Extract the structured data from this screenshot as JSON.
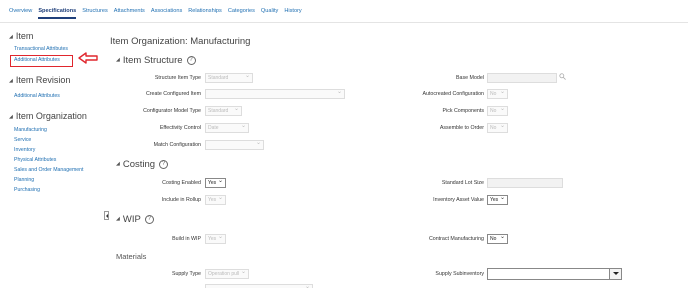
{
  "tabs": [
    "Overview",
    "Specifications",
    "Structures",
    "Attachments",
    "Associations",
    "Relationships",
    "Categories",
    "Quality",
    "History"
  ],
  "active_tab": "Specifications",
  "sidebar": {
    "item": {
      "title": "Item",
      "links": [
        "Transactional Attributes",
        "Additional Attributes"
      ]
    },
    "item_revision": {
      "title": "Item Revision",
      "links": [
        "Additional Attributes"
      ]
    },
    "item_organization": {
      "title": "Item Organization",
      "links": [
        "Manufacturing",
        "Service",
        "Inventory",
        "Physical Attributes",
        "Sales and Order Management",
        "Planning",
        "Purchasing"
      ]
    }
  },
  "main": {
    "title": "Item Organization: Manufacturing",
    "item_structure": {
      "title": "Item Structure",
      "structure_item_type": {
        "label": "Structure Item Type",
        "value": "Standard"
      },
      "create_configured_item": {
        "label": "Create Configured Item",
        "value": ""
      },
      "configurator_model_type": {
        "label": "Configurator Model Type",
        "value": "Standard"
      },
      "effectivity_control": {
        "label": "Effectivity Control",
        "value": "Date"
      },
      "match_configuration": {
        "label": "Match Configuration",
        "value": ""
      },
      "base_model": {
        "label": "Base Model",
        "value": ""
      },
      "autocreated_configuration": {
        "label": "Autocreated Configuration",
        "value": "No"
      },
      "pick_components": {
        "label": "Pick Components",
        "value": "No"
      },
      "assemble_to_order": {
        "label": "Assemble to Order",
        "value": "No"
      }
    },
    "costing": {
      "title": "Costing",
      "costing_enabled": {
        "label": "Costing Enabled",
        "value": "Yes"
      },
      "include_in_rollup": {
        "label": "Include in Rollup",
        "value": "Yes"
      },
      "standard_lot_size": {
        "label": "Standard Lot Size",
        "value": ""
      },
      "inventory_asset_value": {
        "label": "Inventory Asset Value",
        "value": "Yes"
      }
    },
    "wip": {
      "title": "WIP",
      "build_in_wip": {
        "label": "Build in WIP",
        "value": "Yes"
      },
      "contract_manufacturing": {
        "label": "Contract Manufacturing",
        "value": "No"
      }
    },
    "materials": {
      "title": "Materials",
      "supply_type": {
        "label": "Supply Type",
        "value": "Operation pull"
      },
      "supply_subinventory": {
        "label": "Supply Subinventory",
        "value": ""
      }
    }
  },
  "colors": {
    "link": "#1f6fb2",
    "active_tab": "#1f3f7a",
    "highlight": "#e0262d"
  }
}
